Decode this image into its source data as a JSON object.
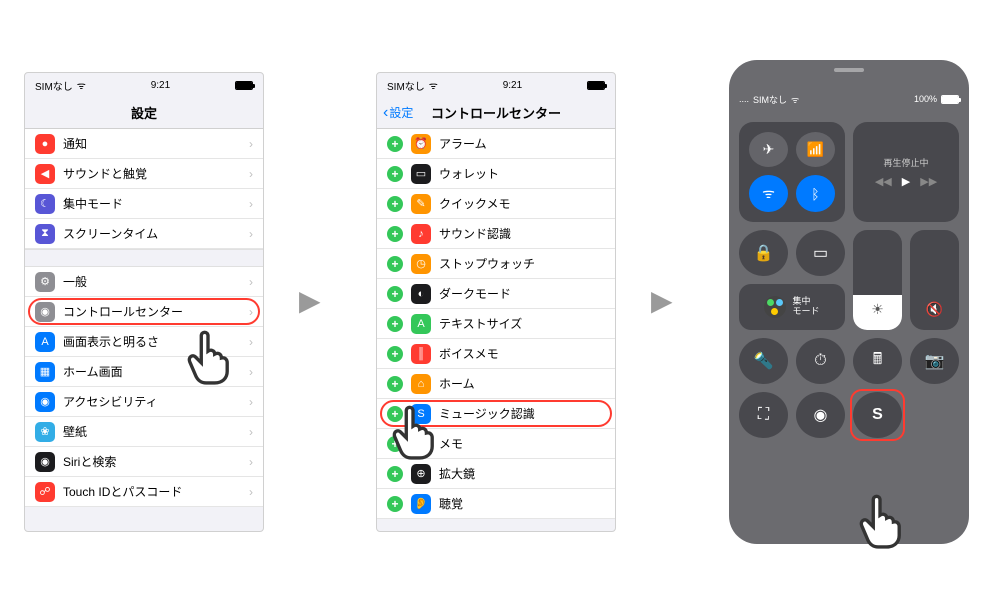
{
  "status": {
    "carrier": "SIMなし",
    "time": "9:21",
    "battery": "100%"
  },
  "phone1": {
    "title": "設定",
    "rows_a": [
      {
        "label": "通知",
        "color": "ic-red",
        "glyph": "●"
      },
      {
        "label": "サウンドと触覚",
        "color": "ic-red",
        "glyph": "◀"
      },
      {
        "label": "集中モード",
        "color": "ic-purple",
        "glyph": "☾"
      },
      {
        "label": "スクリーンタイム",
        "color": "ic-purple",
        "glyph": "⧗"
      }
    ],
    "rows_b": [
      {
        "label": "一般",
        "color": "ic-gray",
        "glyph": "⚙"
      },
      {
        "label": "コントロールセンター",
        "color": "ic-gray",
        "glyph": "◉",
        "hl": true
      },
      {
        "label": "画面表示と明るさ",
        "color": "ic-blue",
        "glyph": "A"
      },
      {
        "label": "ホーム画面",
        "color": "ic-blue",
        "glyph": "▦"
      },
      {
        "label": "アクセシビリティ",
        "color": "ic-blue",
        "glyph": "◉"
      },
      {
        "label": "壁紙",
        "color": "ic-teal",
        "glyph": "❀"
      },
      {
        "label": "Siriと検索",
        "color": "ic-black",
        "glyph": "◉"
      },
      {
        "label": "Touch IDとパスコード",
        "color": "ic-red",
        "glyph": "☍"
      }
    ]
  },
  "phone2": {
    "back": "設定",
    "title": "コントロールセンター",
    "rows": [
      {
        "label": "アラーム",
        "color": "ic-orange",
        "glyph": "⏰"
      },
      {
        "label": "ウォレット",
        "color": "ic-black",
        "glyph": "▭"
      },
      {
        "label": "クイックメモ",
        "color": "ic-orange",
        "glyph": "✎"
      },
      {
        "label": "サウンド認識",
        "color": "ic-red",
        "glyph": "♪"
      },
      {
        "label": "ストップウォッチ",
        "color": "ic-orange",
        "glyph": "◷"
      },
      {
        "label": "ダークモード",
        "color": "ic-black",
        "glyph": "◐"
      },
      {
        "label": "テキストサイズ",
        "color": "ic-green",
        "glyph": "A"
      },
      {
        "label": "ボイスメモ",
        "color": "ic-red",
        "glyph": "║"
      },
      {
        "label": "ホーム",
        "color": "ic-orange",
        "glyph": "⌂"
      },
      {
        "label": "ミュージック認識",
        "color": "ic-blue",
        "glyph": "S",
        "hl": true
      },
      {
        "label": "メモ",
        "color": "ic-orange",
        "glyph": "✎"
      },
      {
        "label": "拡大鏡",
        "color": "ic-black",
        "glyph": "⊕"
      },
      {
        "label": "聴覚",
        "color": "ic-blue",
        "glyph": "👂"
      }
    ]
  },
  "phone3": {
    "media": "再生停止中",
    "focus": "集中\nモード"
  }
}
